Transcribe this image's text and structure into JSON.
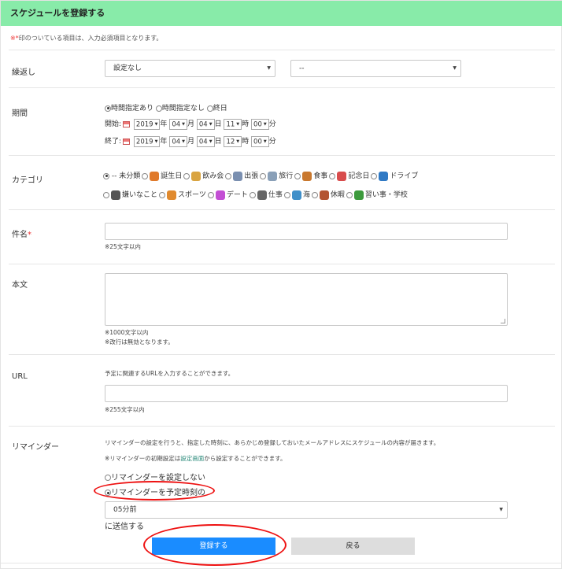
{
  "header": {
    "title": "スケジュールを登録する"
  },
  "note": {
    "star": "※*",
    "text": "印のついている項目は、入力必須項目となります。"
  },
  "repeat": {
    "label": "繰返し",
    "select1": "設定なし",
    "select2": "--"
  },
  "period": {
    "label": "期間",
    "radio_time": "時間指定あり",
    "radio_notime": "時間指定なし",
    "radio_allday": "終日",
    "start_label": "開始:",
    "end_label": "終了:",
    "start": {
      "year": "2019",
      "month": "04",
      "day": "04",
      "hour": "11",
      "minute": "00"
    },
    "end": {
      "year": "2019",
      "month": "04",
      "day": "04",
      "hour": "12",
      "minute": "00"
    },
    "unit_year": "年",
    "unit_month": "月",
    "unit_day": "日",
    "unit_hour": "時",
    "unit_minute": "分"
  },
  "category": {
    "label": "カテゴリ",
    "items": [
      "-- 未分類",
      "誕生日",
      "飲み会",
      "出張",
      "旅行",
      "食事",
      "記念日",
      "ドライブ",
      "嫌いなこと",
      "スポーツ",
      "デート",
      "仕事",
      "海",
      "休暇",
      "習い事・学校"
    ],
    "icon_colors": [
      "#ffffff",
      "#e07a2b",
      "#d9a441",
      "#7a8fb0",
      "#8aa0b8",
      "#c9782e",
      "#d84c4c",
      "#2f79c4",
      "#555555",
      "#e08a2e",
      "#c34fd4",
      "#666666",
      "#3f8fc9",
      "#b35533",
      "#3c9a3c"
    ]
  },
  "subject": {
    "label": "件名",
    "req": "*",
    "hint": "※25文字以内"
  },
  "body": {
    "label": "本文",
    "hint1": "※1000文字以内",
    "hint2": "※改行は無効となります。"
  },
  "url": {
    "label": "URL",
    "desc": "予定に関連するURLを入力することができます。",
    "hint": "※255文字以内"
  },
  "reminder": {
    "label": "リマインダー",
    "desc": "リマインダーの設定を行うと、指定した時刻に、あらかじめ登録しておいたメールアドレスにスケジュールの内容が届きます。",
    "desc2_pre": "※リマインダーの初期設定は",
    "desc2_link": "設定画面",
    "desc2_post": "から設定することができます。",
    "opt_none": "リマインダーを設定しない",
    "opt_before": "リマインダーを予定時刻の",
    "select": "05分前",
    "suffix": "に送信する"
  },
  "buttons": {
    "submit": "登録する",
    "back": "戻る"
  }
}
